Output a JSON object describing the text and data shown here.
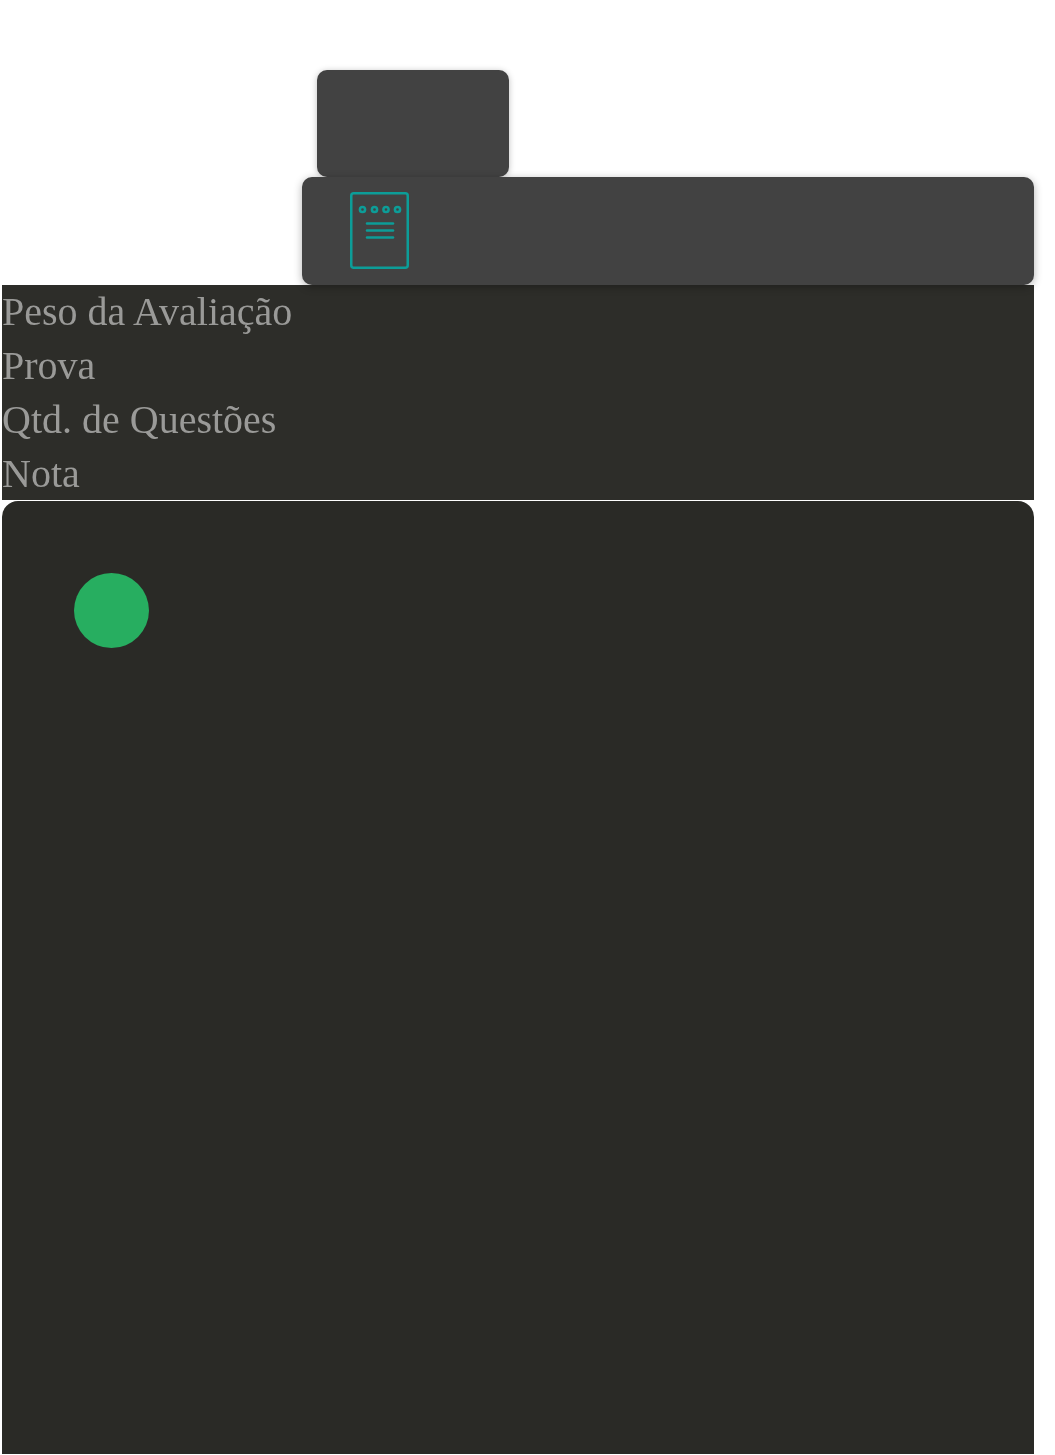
{
  "labels": [
    {
      "text": "Peso da Avaliação"
    },
    {
      "text": "Prova"
    },
    {
      "text": "Qtd. de Questões"
    },
    {
      "text": "Nota"
    }
  ]
}
